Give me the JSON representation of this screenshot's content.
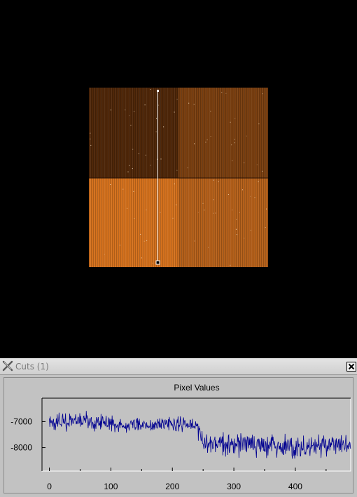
{
  "window": {
    "title": "Cuts (1)"
  },
  "icons": {
    "app": "x-logo-icon",
    "close": "close-icon"
  },
  "colors": {
    "plot_line": "#000090",
    "image_dark": "#4a2408",
    "image_light": "#e0781e",
    "plot_bg": "#c2c2c2"
  },
  "chart_data": {
    "type": "line",
    "title": "Pixel Values",
    "xlabel": "",
    "ylabel": "",
    "xlim": [
      -12,
      490
    ],
    "ylim": [
      -8900,
      -6100
    ],
    "x_ticks": [
      0,
      100,
      200,
      300,
      400
    ],
    "y_ticks": [
      -7000,
      -8000
    ],
    "grid": false,
    "series": [
      {
        "x": [
          0,
          10,
          20,
          30,
          40,
          50,
          60,
          70,
          80,
          90,
          100,
          110,
          120,
          130,
          140,
          150,
          160,
          170,
          180,
          190,
          200,
          210,
          220,
          230,
          240,
          245,
          250,
          260,
          270,
          280,
          290,
          300,
          310,
          320,
          330,
          340,
          350,
          360,
          370,
          380,
          390,
          400,
          410,
          420,
          430,
          440,
          450,
          460,
          470,
          480,
          490
        ],
        "values": [
          -7050,
          -7020,
          -7000,
          -6980,
          -6970,
          -6980,
          -7000,
          -7020,
          -7040,
          -7060,
          -7080,
          -7100,
          -7090,
          -7080,
          -7090,
          -7100,
          -7120,
          -7110,
          -7090,
          -7080,
          -7070,
          -7080,
          -7100,
          -7120,
          -7150,
          -7600,
          -7900,
          -7870,
          -7850,
          -7860,
          -7880,
          -7900,
          -7890,
          -7870,
          -7880,
          -7900,
          -7920,
          -7910,
          -7890,
          -7900,
          -7920,
          -7930,
          -7910,
          -7900,
          -7920,
          -7940,
          -7930,
          -7920,
          -7940,
          -7950,
          -7950
        ],
        "noise_amplitude": [
          350,
          350,
          360,
          360,
          350,
          350,
          340,
          340,
          330,
          330,
          320,
          320,
          320,
          310,
          310,
          310,
          300,
          300,
          300,
          300,
          300,
          300,
          300,
          300,
          300,
          450,
          480,
          480,
          480,
          480,
          480,
          470,
          470,
          470,
          470,
          470,
          460,
          460,
          460,
          460,
          460,
          460,
          450,
          450,
          450,
          450,
          450,
          440,
          440,
          440,
          440
        ]
      }
    ]
  }
}
